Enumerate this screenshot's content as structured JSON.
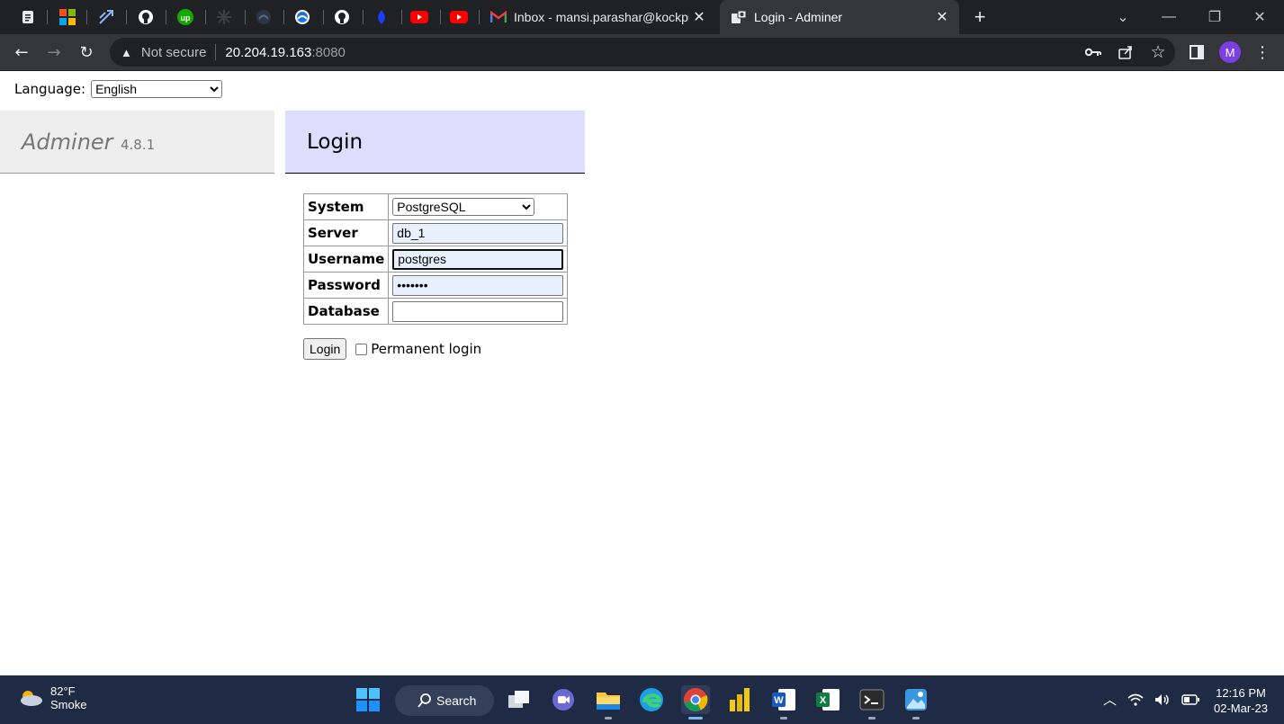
{
  "browser": {
    "tabs": [
      {
        "title": "Inbox - mansi.parashar@kockpit.",
        "active": false
      },
      {
        "title": "Login - Adminer",
        "active": true
      }
    ],
    "new_tab_label": "+",
    "address": {
      "security_label": "Not secure",
      "host": "20.204.19.163",
      "port": ":8080"
    },
    "profile_initial": "M"
  },
  "page": {
    "language_label": "Language:",
    "language_value": "English",
    "brand": "Adminer",
    "version": "4.8.1",
    "heading": "Login",
    "form": {
      "system_label": "System",
      "system_value": "PostgreSQL",
      "server_label": "Server",
      "server_value": "db_1",
      "username_label": "Username",
      "username_value": "postgres",
      "password_label": "Password",
      "password_value": "•••••••",
      "database_label": "Database",
      "database_value": ""
    },
    "login_button": "Login",
    "permanent_label": "Permanent login"
  },
  "taskbar": {
    "weather_temp": "82°F",
    "weather_desc": "Smoke",
    "search_label": "Search",
    "time": "12:16 PM",
    "date": "02-Mar-23"
  },
  "colors": {
    "adminer_menu_bg": "#eeeeee",
    "adminer_heading_bg": "#ddddff",
    "chrome_dark": "#202124",
    "taskbar_bg": "#1f2b44"
  }
}
